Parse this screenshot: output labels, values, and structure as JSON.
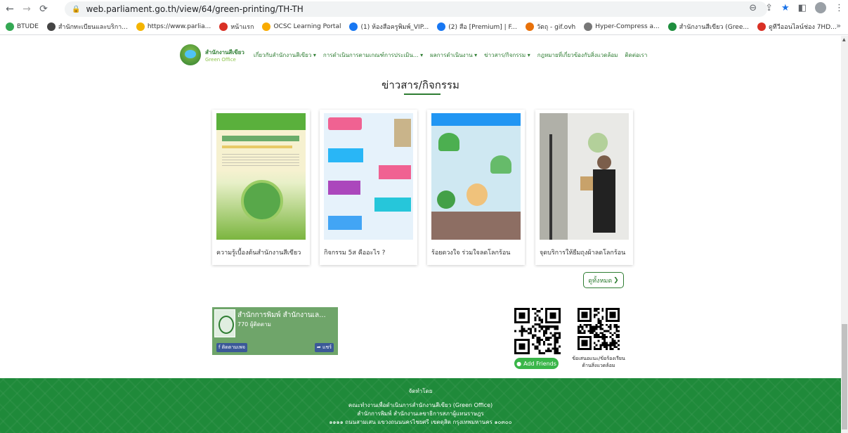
{
  "browser": {
    "url": "web.parliament.go.th/view/64/green-printing/TH-TH",
    "bookmarks": [
      {
        "label": "BTUDE",
        "color": "#34a853"
      },
      {
        "label": "สำนักทะเบียนและบริกา...",
        "color": "#444444"
      },
      {
        "label": "https://www.parlia...",
        "color": "#f4b400"
      },
      {
        "label": "หน้าแรก",
        "color": "#d93025"
      },
      {
        "label": "OCSC Learning Portal",
        "color": "#f9ab00"
      },
      {
        "label": "(1) ห้องสือครูพิมพ์_VIP...",
        "color": "#1877f2"
      },
      {
        "label": "(2) สือ [Premium] | F...",
        "color": "#1877f2"
      },
      {
        "label": "วัตถุ - gif.ovh",
        "color": "#e8710a"
      },
      {
        "label": "Hyper-Compress a...",
        "color": "#777777"
      },
      {
        "label": "สำนักงานสีเขียว (Gree...",
        "color": "#1e8e3e"
      },
      {
        "label": "ดูทีวีออนไลน์ช่อง 7HD...",
        "color": "#d93025"
      }
    ],
    "more_bookmarks": "»"
  },
  "site": {
    "brand_line1": "สำนักงานสีเขียว",
    "brand_line2": "Green Office",
    "menu": [
      "เกี่ยวกับสำนักงานสีเขียว ▾",
      "การดำเนินการตามเกณฑ์การประเมิน... ▾",
      "ผลการดำเนินงาน ▾",
      "ข่าวสาร/กิจกรรม ▾",
      "กฎหมายที่เกี่ยวข้องกับสิ่งแวดล้อม",
      "ติดต่อเรา"
    ]
  },
  "news": {
    "title": "ข่าวสาร/กิจกรรม",
    "cards": [
      "ความรู้เบื้องต้นสำนักงานสีเขียว",
      "กิจกรรม 5ส คืออะไร ?",
      "ร้อยดวงใจ ร่วมใจลดโลกร้อน",
      "จุดบริการให้ยืมถุงผ้าลดโลกร้อน"
    ],
    "see_all": "ดูทั้งหมด"
  },
  "facebook": {
    "name": "สำนักการพิมพ์ สำนักงานเล...",
    "followers": "770 ผู้ติดตาม",
    "follow": "ติดตามเพจ",
    "share": "แชร์"
  },
  "contact": {
    "add_friend": "Add Friends",
    "complaint": "ข้อเสนอแนะ/ข้อร้องเรียน ด้านสิ่งแวดล้อม"
  },
  "footer": {
    "by": "จัดทำโดย",
    "line1": "คณะทำงานเพื่อดำเนินการสำนักงานสีเขียว (Green Office)",
    "line2": "สำนักการพิมพ์ สำนักงานเลขาธิการสภาผู้แทนราษฎร",
    "line3": "๑๑๑๑ ถนนสามเสน แขวงถนนนครไชยศรี เขตดุสิต กรุงเทพมหานคร ๑๐๓๐๐"
  }
}
